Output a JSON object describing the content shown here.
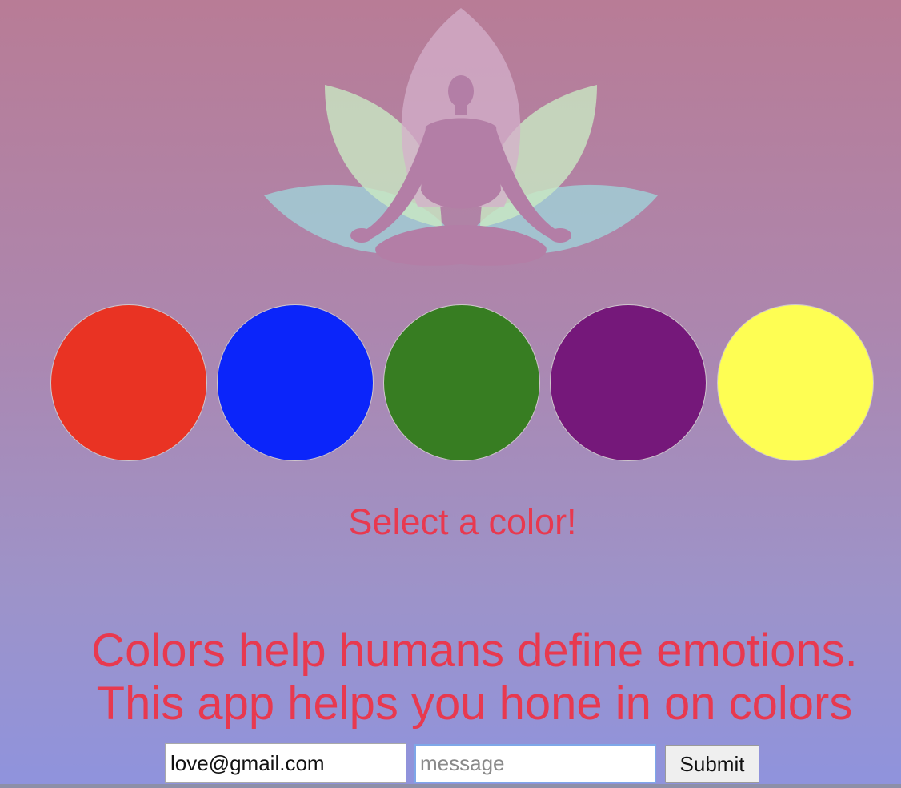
{
  "logo": {
    "icon": "meditation-lotus-icon"
  },
  "color_options": [
    {
      "name": "red",
      "color": "#e93323"
    },
    {
      "name": "blue",
      "color": "#0b25fa"
    },
    {
      "name": "green",
      "color": "#377d22"
    },
    {
      "name": "purple",
      "color": "#75187a"
    },
    {
      "name": "yellow",
      "color": "#fefe53"
    }
  ],
  "prompt": "Select a color!",
  "headline": {
    "line1": "Colors help humans define emotions.",
    "line2": "This app helps you hone in on colors"
  },
  "form": {
    "email_value": "love@gmail.com",
    "message_placeholder": "message",
    "submit_label": "Submit"
  },
  "colors": {
    "text_accent": "#e8394f",
    "focus_ring": "#7ea7e8"
  }
}
